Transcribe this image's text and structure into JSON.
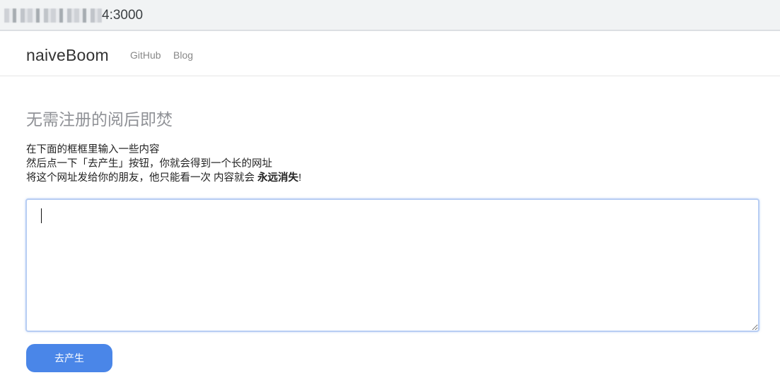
{
  "browser": {
    "url_suffix": "4:3000"
  },
  "navbar": {
    "brand": "naiveBoom",
    "links": [
      {
        "label": "GitHub"
      },
      {
        "label": "Blog"
      }
    ]
  },
  "main": {
    "title": "无需注册的阅后即焚",
    "instructions": {
      "line1": "在下面的框框里输入一些内容",
      "line2": "然后点一下「去产生」按钮，你就会得到一个长的网址",
      "line3_prefix": "将这个网址发给你的朋友，他只能看一次 内容就会 ",
      "line3_emphasis": "永远消失",
      "line3_suffix": "!"
    },
    "textarea": {
      "value": "",
      "placeholder": ""
    },
    "submit_label": "去产生"
  }
}
